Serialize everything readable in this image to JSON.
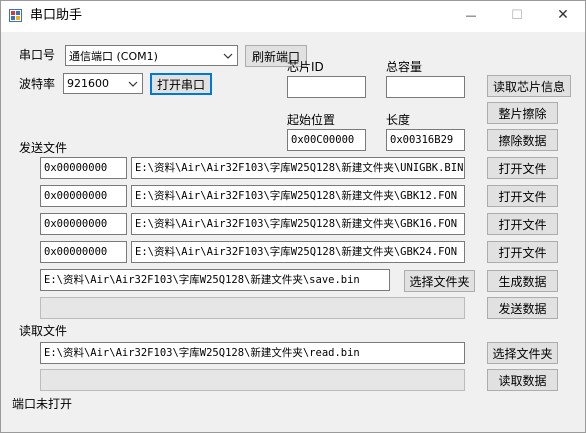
{
  "window": {
    "title": "串口助手",
    "minimize_glyph": "—",
    "maximize_glyph": "☐",
    "close_glyph": "✕"
  },
  "serial": {
    "port_label": "串口号",
    "port_value": "通信端口 (COM1)",
    "refresh_label": "刷新端口",
    "baud_label": "波特率",
    "baud_value": "921600",
    "open_label": "打开串口"
  },
  "chip": {
    "id_label": "芯片ID",
    "id_value": "",
    "capacity_label": "总容量",
    "capacity_value": "",
    "read_info_label": "读取芯片信息",
    "erase_chip_label": "整片擦除",
    "start_label": "起始位置",
    "start_value": "0x00C00000",
    "length_label": "长度",
    "length_value": "0x00316B29",
    "erase_data_label": "擦除数据"
  },
  "send": {
    "section_label": "发送文件",
    "rows": [
      {
        "addr": "0x00000000",
        "path": "E:\\资料\\Air\\Air32F103\\字库W25Q128\\新建文件夹\\UNIGBK.BIN",
        "button": "打开文件"
      },
      {
        "addr": "0x00000000",
        "path": "E:\\资料\\Air\\Air32F103\\字库W25Q128\\新建文件夹\\GBK12.FON",
        "button": "打开文件"
      },
      {
        "addr": "0x00000000",
        "path": "E:\\资料\\Air\\Air32F103\\字库W25Q128\\新建文件夹\\GBK16.FON",
        "button": "打开文件"
      },
      {
        "addr": "0x00000000",
        "path": "E:\\资料\\Air\\Air32F103\\字库W25Q128\\新建文件夹\\GBK24.FON",
        "button": "打开文件"
      }
    ],
    "save_path": "E:\\资料\\Air\\Air32F103\\字库W25Q128\\新建文件夹\\save.bin",
    "choose_folder_label": "选择文件夹",
    "generate_label": "生成数据",
    "send_label": "发送数据",
    "progress": 0
  },
  "read": {
    "section_label": "读取文件",
    "path": "E:\\资料\\Air\\Air32F103\\字库W25Q128\\新建文件夹\\read.bin",
    "choose_folder_label": "选择文件夹",
    "read_label": "读取数据",
    "progress": 0
  },
  "status": {
    "text": "端口未打开"
  }
}
